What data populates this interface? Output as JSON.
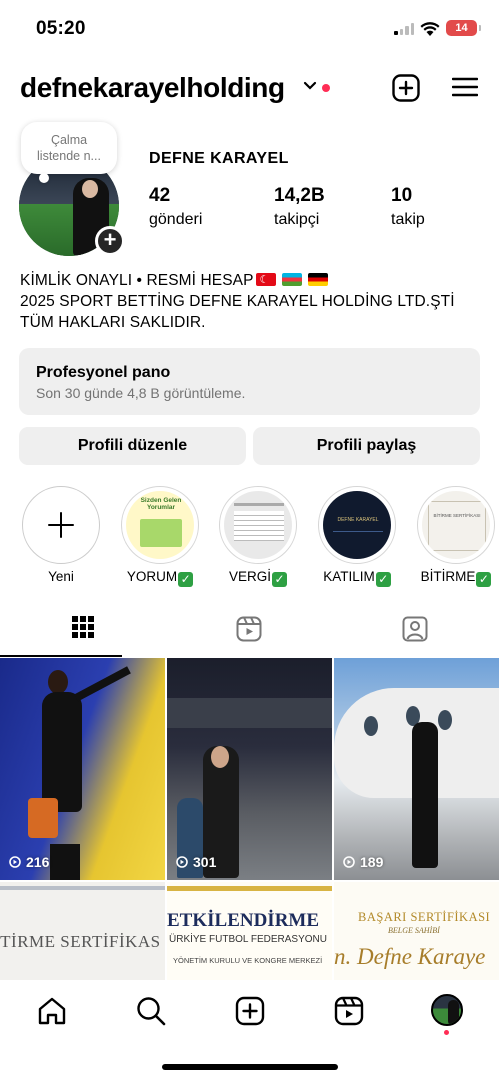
{
  "status_bar": {
    "time": "05:20",
    "battery": "14"
  },
  "header": {
    "username": "defnekarayelholding"
  },
  "profile": {
    "note": "Çalma listende n...",
    "display_name": "DEFNE KARAYEL",
    "stats": [
      {
        "num": "42",
        "label": "gönderi"
      },
      {
        "num": "14,2B",
        "label": "takipçi"
      },
      {
        "num": "10",
        "label": "takip"
      }
    ],
    "bio_line1": "KİMLİK ONAYLI • RESMİ HESAP",
    "bio_line2": "2025 SPORT BETTİNG DEFNE KARAYEL HOLDİNG LTD.ŞTİ",
    "bio_line3": "TÜM HAKLARI SAKLIDIR."
  },
  "pro_panel": {
    "title": "Profesyonel pano",
    "subtitle": "Son 30 günde 4,8 B görüntüleme."
  },
  "buttons": {
    "edit": "Profili düzenle",
    "share": "Profili paylaş"
  },
  "highlights": [
    {
      "label": "Yeni"
    },
    {
      "label": "YORUM"
    },
    {
      "label": "VERGİ"
    },
    {
      "label": "KATILIM"
    },
    {
      "label": "BİTİRME"
    }
  ],
  "highlight_texts": {
    "yorum_title": "Sizden Gelen Yorumlar",
    "katilim_title": "DEFNE KARAYEL",
    "bitirme_title": "BİTİRME SERTİFİKASI"
  },
  "posts": [
    {
      "views": "216"
    },
    {
      "views": "301"
    },
    {
      "views": "189"
    }
  ],
  "post_texts": {
    "post4": "İTİRME SERTİFİKAS",
    "post5_title": "ETKİLENDİRME",
    "post5_sub": "ÜRKİYE FUTBOL FEDERASYONU",
    "post5_sub2": "YÖNETİM KURULU VE KONGRE MERKEZİ",
    "post6_title": "BAŞARI SERTİFİKASI",
    "post6_sub": "BELGE SAHİBİ",
    "post6_name": "n. Defne Karaye"
  },
  "colors": {
    "accent_red": "#ff2d55",
    "panel_bg": "#efefef",
    "muted": "#737373"
  }
}
